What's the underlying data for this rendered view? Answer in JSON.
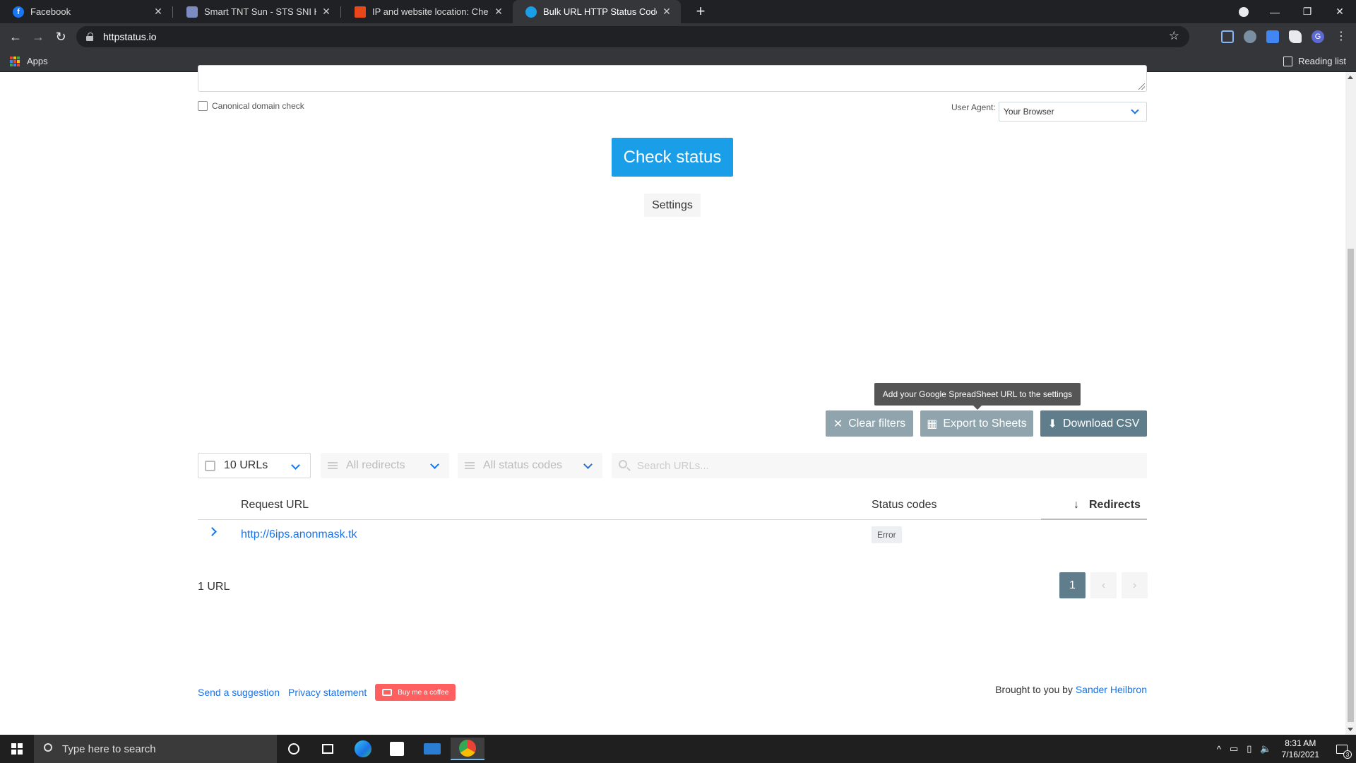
{
  "browser": {
    "tabs": [
      {
        "title": "Facebook",
        "favicon": "facebook-icon",
        "color": "#1877f2"
      },
      {
        "title": "Smart TNT Sun - STS SNI Host | F",
        "favicon": "shield-icon",
        "color": "#7a8cc2"
      },
      {
        "title": "IP and website location: Check ho",
        "favicon": "ip-location-icon",
        "color": "#e8471c"
      },
      {
        "title": "Bulk URL HTTP Status Code, Hea",
        "favicon": "globe-icon",
        "color": "#1a9ee8"
      }
    ],
    "address": "httpstatus.io",
    "bookmarks": {
      "apps": "Apps",
      "reading_list": "Reading list"
    }
  },
  "form": {
    "canonical_label": "Canonical domain check",
    "user_agent_label": "User Agent:",
    "user_agent_value": "Your Browser",
    "check_button": "Check status",
    "settings_button": "Settings"
  },
  "actions": {
    "tooltip": "Add your Google SpreadSheet URL to the settings",
    "clear_filters": "Clear filters",
    "export_sheets": "Export to Sheets",
    "download_csv": "Download CSV"
  },
  "filters": {
    "urls": "10 URLs",
    "redirects": "All redirects",
    "status_codes": "All status codes",
    "search_placeholder": "Search URLs..."
  },
  "table": {
    "headers": {
      "request_url": "Request URL",
      "status_codes": "Status codes",
      "redirects": "Redirects"
    },
    "rows": [
      {
        "url": "http://6ips.anonmask.tk",
        "status": "Error"
      }
    ]
  },
  "summary": {
    "count": "1 URL"
  },
  "pagination": {
    "current": "1",
    "prev": "‹",
    "next": "›"
  },
  "footer": {
    "suggestion": "Send a suggestion",
    "privacy": "Privacy statement",
    "coffee": "Buy me a coffee",
    "brought": "Brought to you by",
    "author": "Sander Heilbron"
  },
  "taskbar": {
    "search_placeholder": "Type here to search",
    "time": "8:31 AM",
    "date": "7/16/2021",
    "notifications": "3"
  }
}
